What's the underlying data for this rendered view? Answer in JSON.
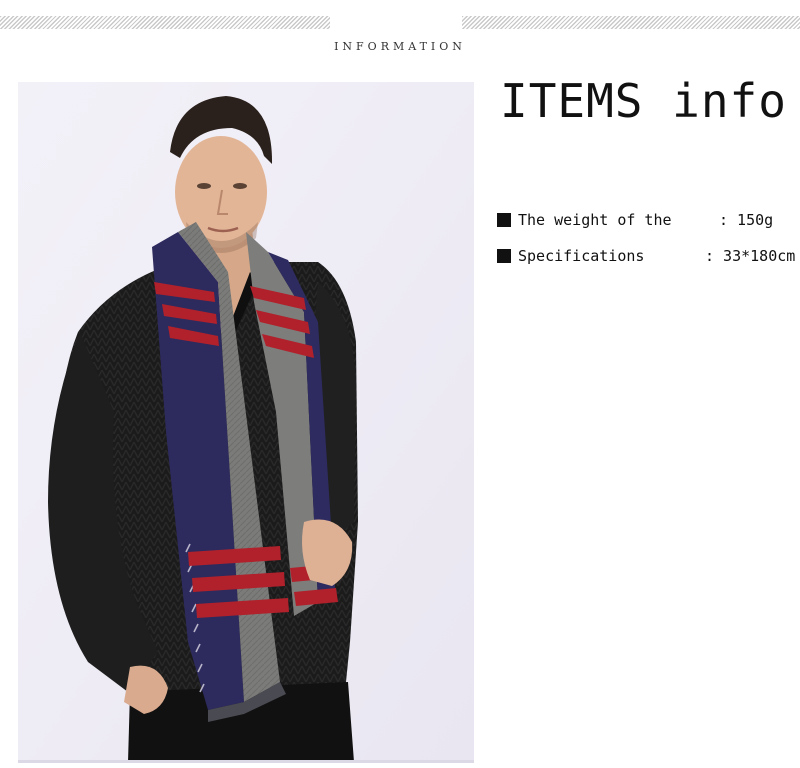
{
  "header": {
    "section_label": "INFORMATION"
  },
  "product_image": {
    "alt": "Man wearing a navy, grey and red striped scarf over a black sweater",
    "colors": {
      "background": "#f0eef6",
      "scarf_navy": "#2c2a5c",
      "scarf_grey": "#7a7a78",
      "scarf_red": "#b0202a",
      "sweater": "#1a1a1a"
    }
  },
  "info": {
    "title": "ITEMS info",
    "specs": [
      {
        "label": "The weight of the",
        "value": ": 150g"
      },
      {
        "label": "Specifications",
        "value": ": 33*180cm"
      }
    ]
  }
}
